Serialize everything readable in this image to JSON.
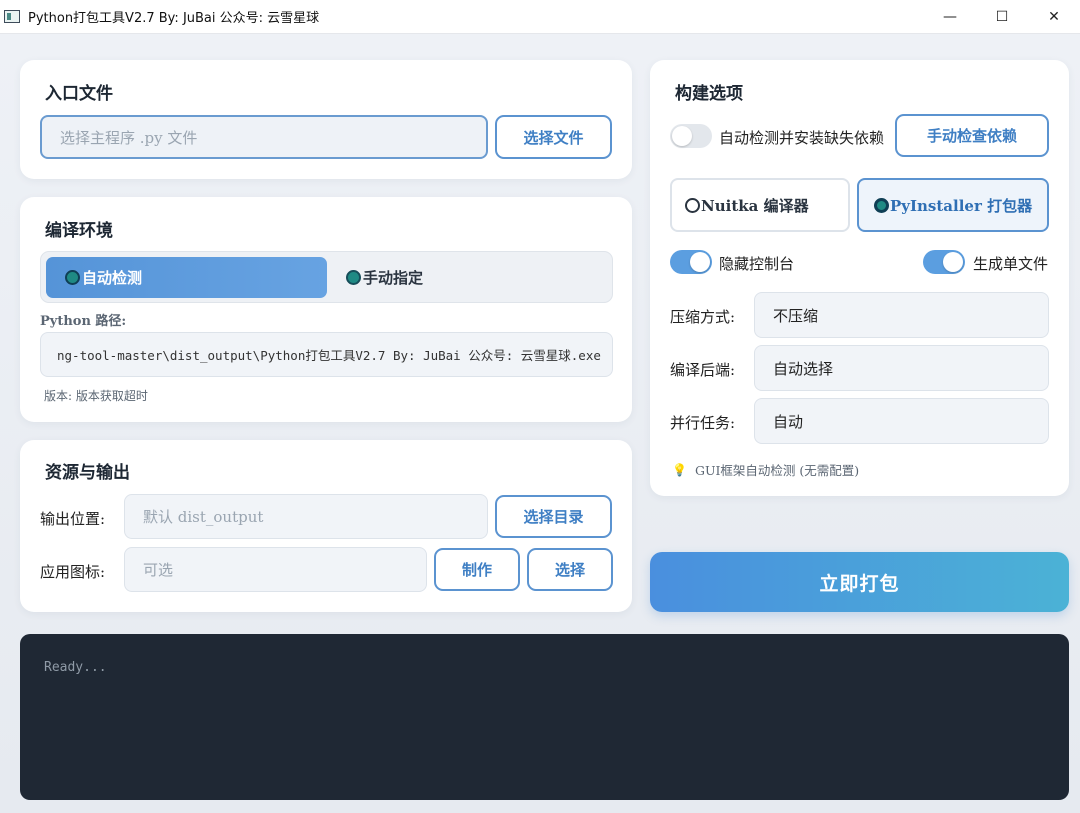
{
  "window": {
    "title": "Python打包工具V2.7 By: JuBai 公众号: 云雪星球",
    "minimize": "—",
    "maximize": "☐",
    "close": "✕"
  },
  "entry": {
    "title": "入口文件",
    "placeholder": "选择主程序 .py 文件",
    "choose_button": "选择文件"
  },
  "env": {
    "title": "编译环境",
    "auto_label": "自动检测",
    "manual_label": "手动指定",
    "python_path_label": "Python 路径:",
    "python_path_value": "ng-tool-master\\dist_output\\Python打包工具V2.7 By: JuBai 公众号: 云雪星球.exe",
    "version_text": "版本: 版本获取超时"
  },
  "resources": {
    "title": "资源与输出",
    "output_label": "输出位置:",
    "output_placeholder": "默认 dist_output",
    "choose_dir_button": "选择目录",
    "icon_label": "应用图标:",
    "icon_placeholder": "可选",
    "make_button": "制作",
    "select_button": "选择"
  },
  "build": {
    "title": "构建选项",
    "auto_deps_label": "自动检测并安装缺失依赖",
    "auto_deps_on": false,
    "check_deps_button": "手动检查依赖",
    "nuitka_label": "Nuitka 编译器",
    "pyinstaller_label": "PyInstaller 打包器",
    "selected_engine": "PyInstaller 打包器",
    "hide_console_label": "隐藏控制台",
    "hide_console_on": true,
    "onefile_label": "生成单文件",
    "onefile_on": true,
    "compress_label": "压缩方式:",
    "compress_value": "不压缩",
    "backend_label": "编译后端:",
    "backend_value": "自动选择",
    "jobs_label": "并行任务:",
    "jobs_value": "自动",
    "hint_icon": "💡",
    "hint_text": "GUI框架自动检测 (无需配置)"
  },
  "pack_button": "立即打包",
  "console": {
    "text": "Ready..."
  },
  "colors": {
    "accent": "#5b93d0",
    "radio_teal": "#1f8a84",
    "console_bg": "#1f2834"
  }
}
